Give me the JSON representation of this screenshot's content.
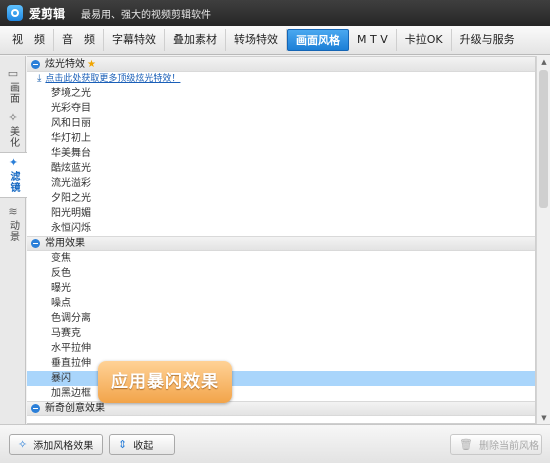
{
  "app": {
    "name": "爱剪辑",
    "slogan": "最易用、强大的视频剪辑软件"
  },
  "tabs": [
    "视　频",
    "音　频",
    "字幕特效",
    "叠加素材",
    "转场特效",
    "画面风格",
    "M T V",
    "卡拉OK",
    "升级与服务"
  ],
  "active_tab": "画面风格",
  "side_tabs": [
    {
      "label": "画面",
      "icon": "layout-icon"
    },
    {
      "label": "美化",
      "icon": "magic-wand-icon"
    },
    {
      "label": "滤镜",
      "icon": "wand-sparkle-icon"
    },
    {
      "label": "动景",
      "icon": "wave-icon"
    }
  ],
  "active_side_tab": "滤镜",
  "groups": {
    "glare": {
      "title": "炫光特效",
      "download_link": "点击此处获取更多顶级炫光特效！",
      "items": [
        "梦境之光",
        "光彩夺目",
        "风和日丽",
        "华灯初上",
        "华美舞台",
        "酷炫蓝光",
        "流光溢彩",
        "夕阳之光",
        "阳光明媚",
        "永恒闪烁"
      ]
    },
    "common": {
      "title": "常用效果",
      "items": [
        "变焦",
        "反色",
        "曝光",
        "噪点",
        "色调分离",
        "马赛克",
        "水平拉伸",
        "垂直拉伸",
        "暴闪",
        "加黑边框"
      ],
      "selected": "暴闪"
    },
    "creative": {
      "title": "新奇创意效果"
    }
  },
  "callout": "应用暴闪效果",
  "buttons": {
    "add_style": "添加风格效果",
    "collapse": "收起",
    "delete_style": "删除当前风格"
  },
  "colors": {
    "accent": "#1c7fd6",
    "selected_row": "#a9d5fb",
    "callout": "#f2a44a"
  }
}
